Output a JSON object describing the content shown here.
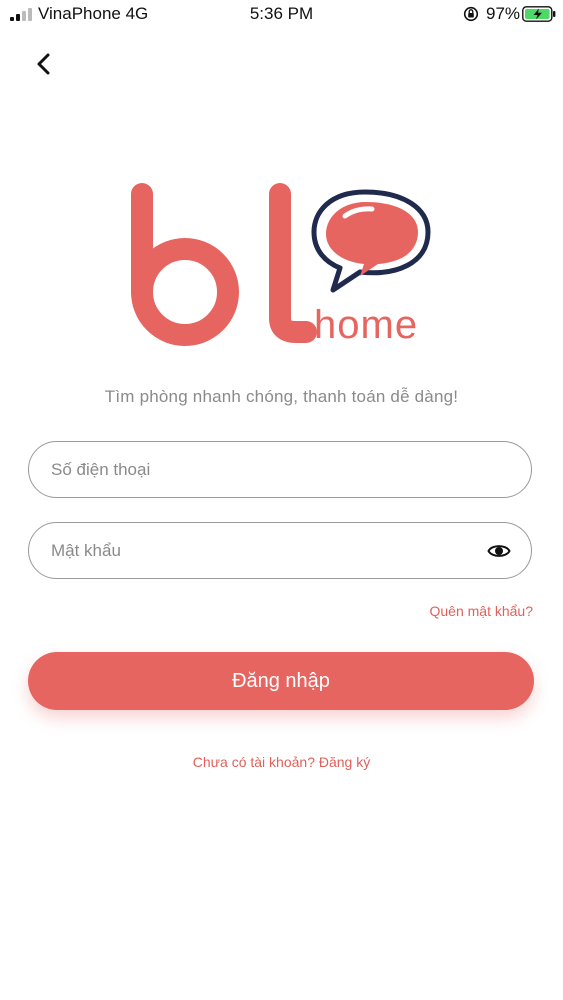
{
  "status_bar": {
    "carrier": "VinaPhone 4G",
    "time": "5:36 PM",
    "battery_percent": "97%",
    "icons": [
      "signal-icon",
      "rotation-lock-icon",
      "battery-charging-icon"
    ]
  },
  "nav": {
    "back_icon": "chevron-left-icon"
  },
  "logo": {
    "letters": "bl",
    "word": "home",
    "bubble_icon": "speech-bubble-icon"
  },
  "tagline": "Tìm phòng nhanh chóng, thanh toán dễ dàng!",
  "form": {
    "phone_placeholder": "Số điện thoại",
    "phone_value": "",
    "password_placeholder": "Mật khẩu",
    "password_value": "",
    "eye_icon": "eye-icon",
    "forgot_password": "Quên mật khẩu?",
    "login_label": "Đăng nhập",
    "signup_text": "Chưa có tài khoản? Đăng ký"
  },
  "colors": {
    "brand": "#e76560",
    "brand_dark": "#1f2a4d",
    "placeholder": "#8a8a8a",
    "border": "#9a9a9a"
  }
}
